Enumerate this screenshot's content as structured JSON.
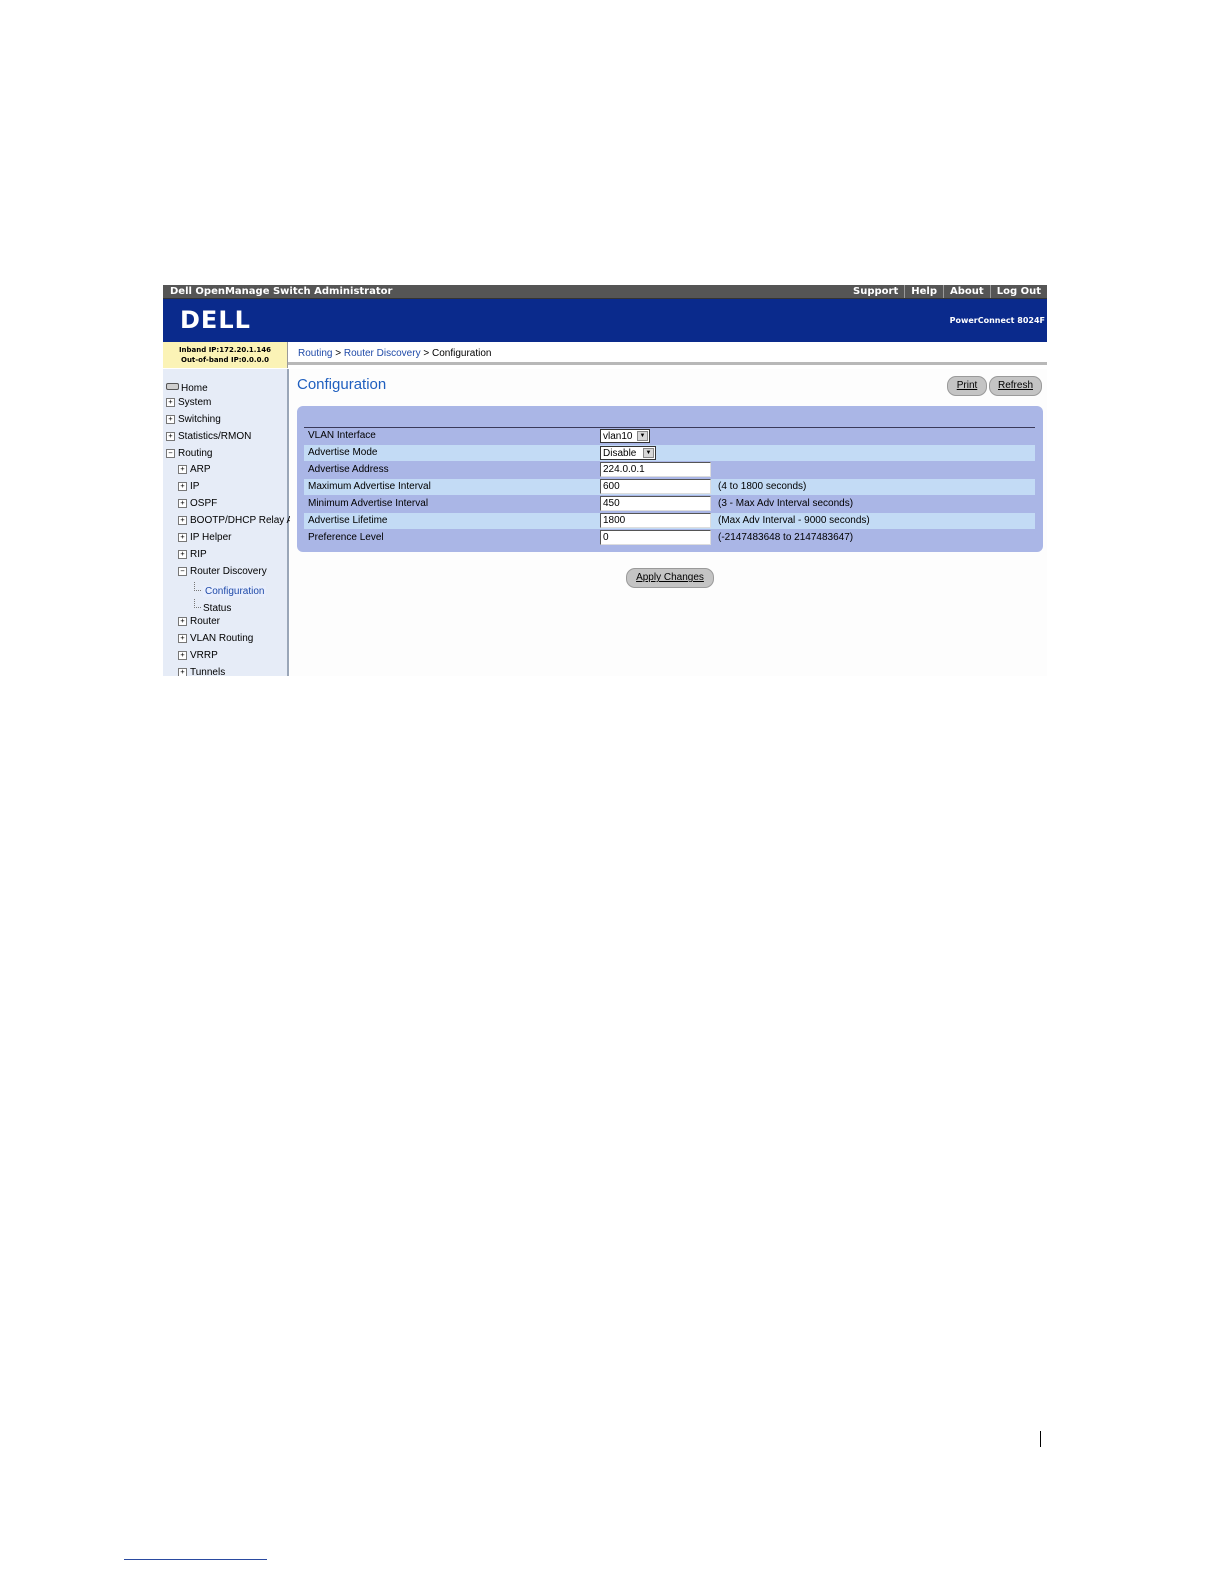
{
  "app": {
    "title": "Dell OpenManage Switch Administrator",
    "links": [
      "Support",
      "Help",
      "About",
      "Log Out"
    ],
    "logo": "DELL",
    "model": "PowerConnect 8024F"
  },
  "ip": {
    "inband": "Inband IP:172.20.1.146",
    "outofband": "Out-of-band IP:0.0.0.0"
  },
  "breadcrumb": {
    "part1": "Routing",
    "sep1": " > ",
    "part2": "Router Discovery",
    "sep2": " > ",
    "current": "Configuration"
  },
  "nav": {
    "home": "Home",
    "system": "System",
    "switching": "Switching",
    "statistics": "Statistics/RMON",
    "routing": "Routing",
    "arp": "ARP",
    "ip": "IP",
    "ospf": "OSPF",
    "bootp": "BOOTP/DHCP Relay A",
    "iphelper": "IP Helper",
    "rip": "RIP",
    "router_discovery": "Router Discovery",
    "configuration": "Configuration",
    "status": "Status",
    "router": "Router",
    "vlan_routing": "VLAN Routing",
    "vrrp": "VRRP",
    "tunnels": "Tunnels"
  },
  "page": {
    "title": "Configuration",
    "print": "Print",
    "refresh": "Refresh",
    "apply": "Apply Changes"
  },
  "form": {
    "vlan_interface": {
      "label": "VLAN Interface",
      "value": "vlan10"
    },
    "advertise_mode": {
      "label": "Advertise Mode",
      "value": "Disable"
    },
    "advertise_address": {
      "label": "Advertise Address",
      "value": "224.0.0.1"
    },
    "max_interval": {
      "label": "Maximum Advertise Interval",
      "value": "600",
      "hint": "(4 to 1800 seconds)"
    },
    "min_interval": {
      "label": "Minimum Advertise Interval",
      "value": "450",
      "hint": "(3 - Max Adv Interval seconds)"
    },
    "lifetime": {
      "label": "Advertise Lifetime",
      "value": "1800",
      "hint": "(Max Adv Interval - 9000 seconds)"
    },
    "preference": {
      "label": "Preference Level",
      "value": "0",
      "hint": "(-2147483648 to 2147483647)"
    }
  },
  "colors": {
    "banner": "#0a2a8c",
    "panel": "#aab6e6",
    "row_alt": "#c3dbf5",
    "title": "#1f5fbf"
  }
}
